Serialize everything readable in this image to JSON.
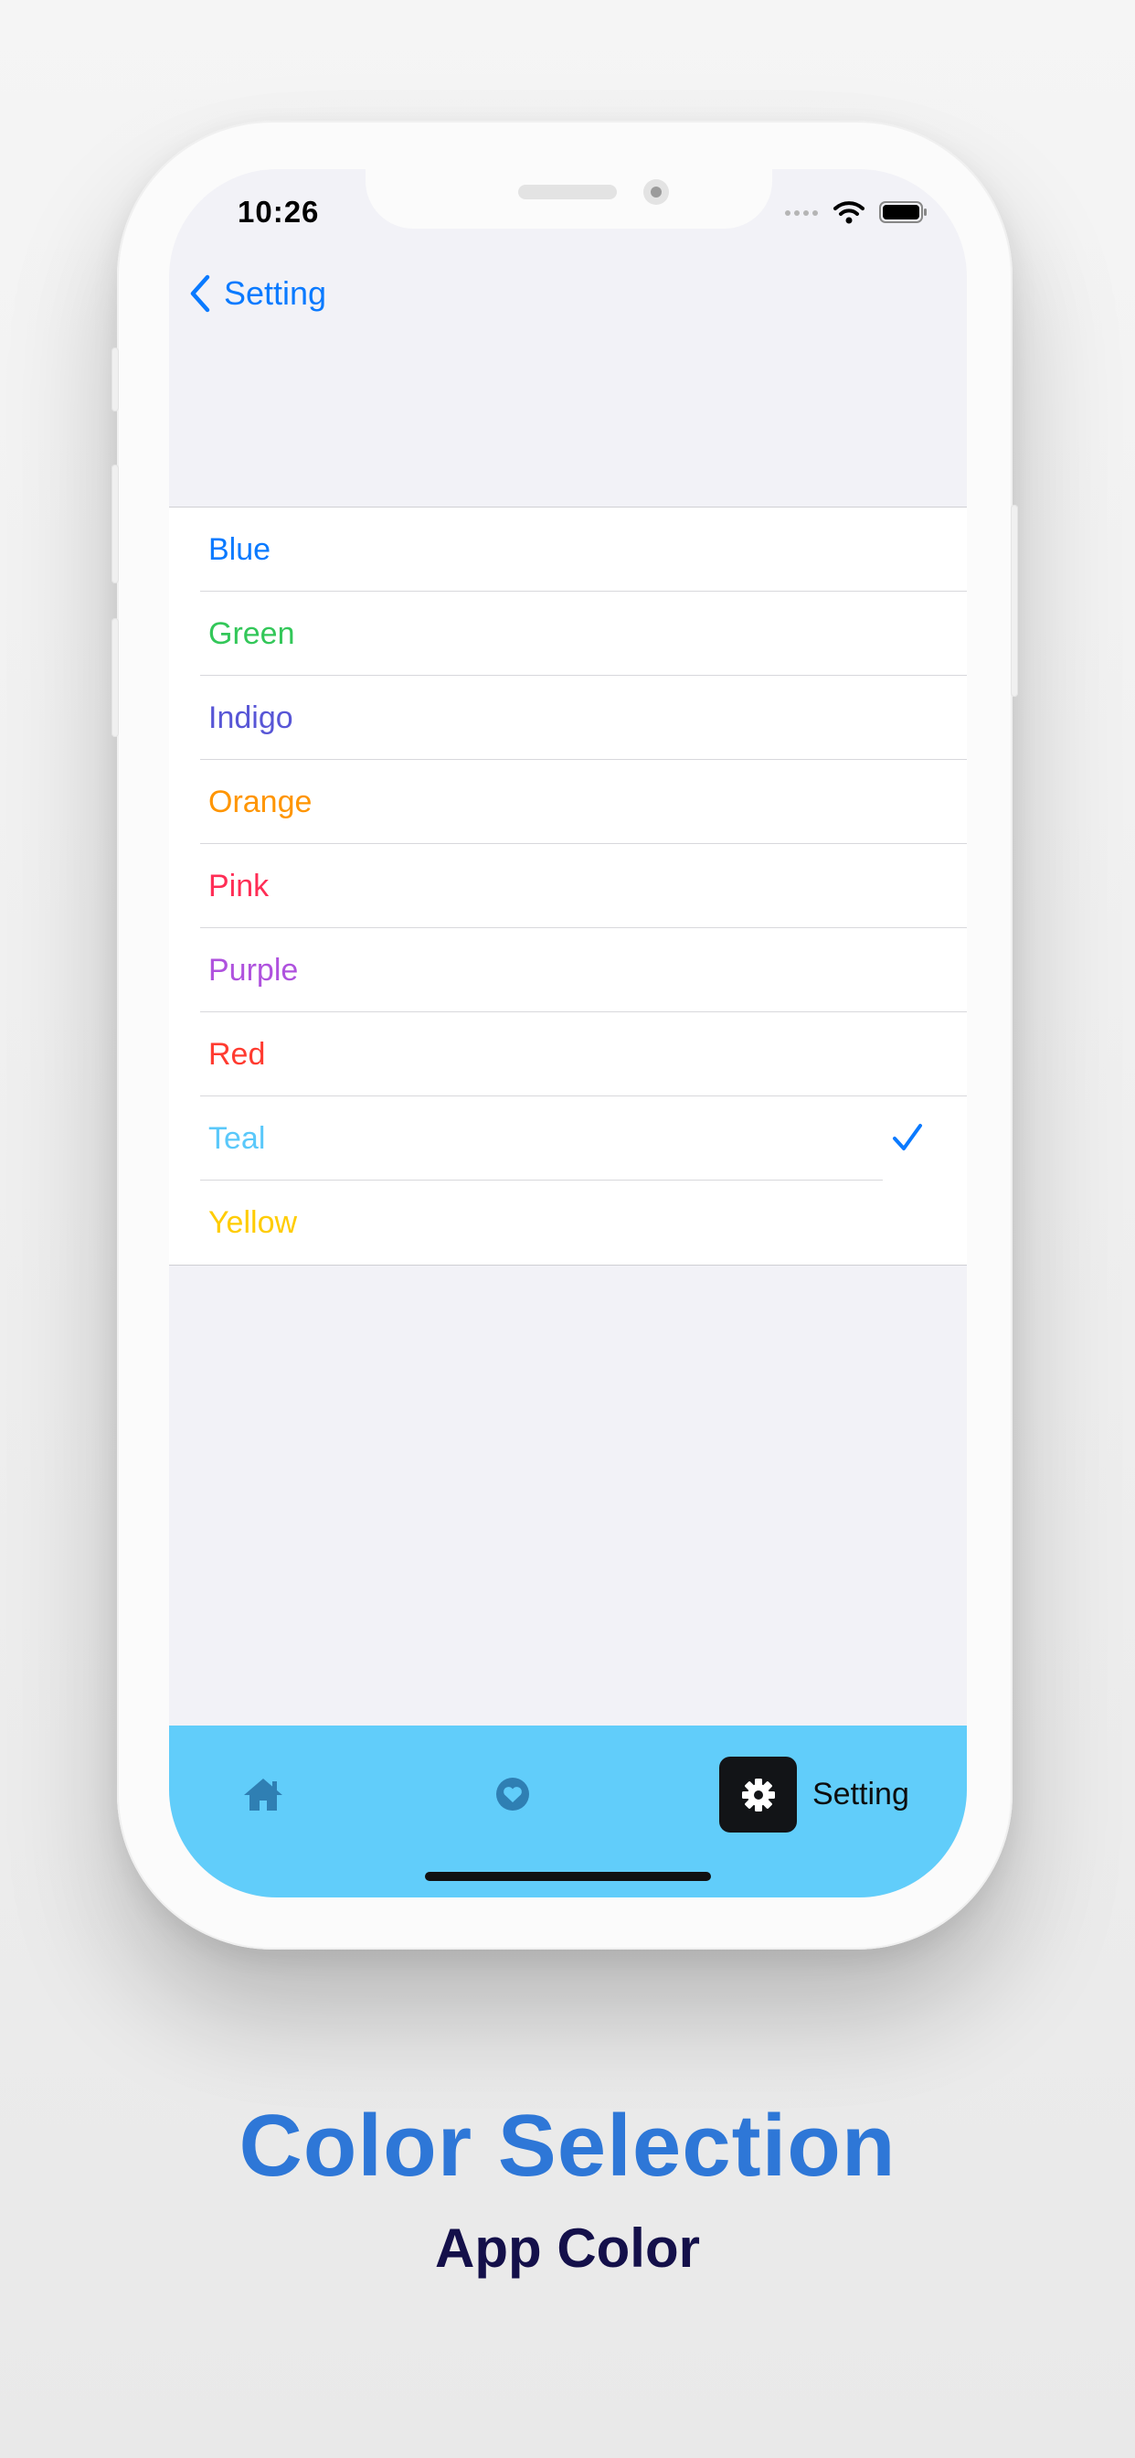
{
  "status_bar": {
    "time": "10:26"
  },
  "nav": {
    "back_label": "Setting"
  },
  "colors": [
    {
      "label": "Blue",
      "color": "#0a7aff",
      "selected": false
    },
    {
      "label": "Green",
      "color": "#33c759",
      "selected": false
    },
    {
      "label": "Indigo",
      "color": "#5856d6",
      "selected": false
    },
    {
      "label": "Orange",
      "color": "#ff9500",
      "selected": false
    },
    {
      "label": "Pink",
      "color": "#ff2d55",
      "selected": false
    },
    {
      "label": "Purple",
      "color": "#af52de",
      "selected": false
    },
    {
      "label": "Red",
      "color": "#ff3b30",
      "selected": false
    },
    {
      "label": "Teal",
      "color": "#5ac8fa",
      "selected": true
    },
    {
      "label": "Yellow",
      "color": "#ffcc00",
      "selected": false
    }
  ],
  "tab_bar": {
    "background": "#61cdfa",
    "tabs": [
      {
        "icon": "home-icon"
      },
      {
        "icon": "heart-icon"
      },
      {
        "icon": "gear-icon",
        "label": "Setting",
        "active": true
      }
    ]
  },
  "caption": {
    "title": "Color Selection",
    "subtitle": "App Color"
  }
}
